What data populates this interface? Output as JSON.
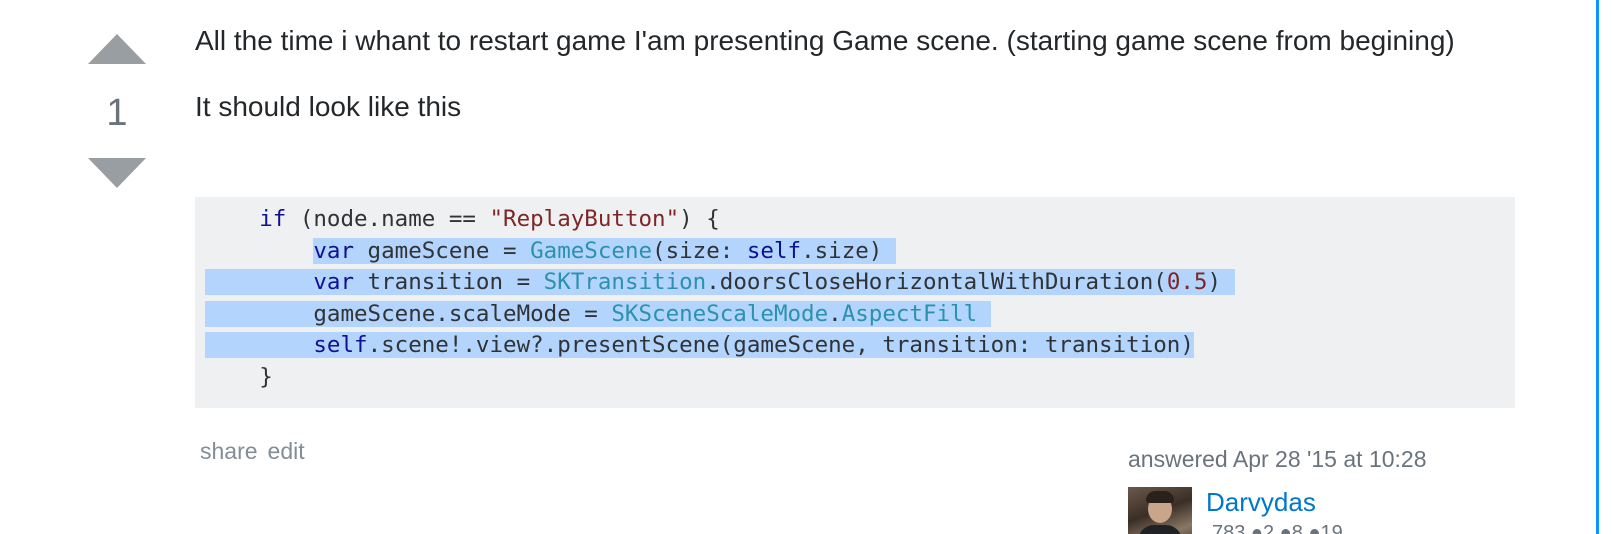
{
  "vote": {
    "count": "1"
  },
  "post": {
    "paragraph1": "All the time i whant to restart game I'am presenting Game scene. (starting game scene from begining)",
    "paragraph2": "It should look like this"
  },
  "code": {
    "line1": {
      "indent": "    ",
      "kw_if": "if",
      "t1": " (node.name == ",
      "str": "\"ReplayButton\"",
      "t2": ") {"
    },
    "line2": {
      "indent": "        ",
      "kw": "var",
      "t1": " gameScene = ",
      "type": "GameScene",
      "t2": "(size: ",
      "kw_self": "self",
      "t3": ".size)"
    },
    "line3": {
      "indent": "        ",
      "kw": "var",
      "t1": " transition = ",
      "type": "SKTransition",
      "t2": ".doorsCloseHorizontalWithDuration(",
      "num": "0.5",
      "t3": ")"
    },
    "line4": {
      "indent": "        ",
      "t1": "gameScene.scaleMode = ",
      "type": "SKSceneScaleMode",
      "t2": ".",
      "type2": "AspectFill"
    },
    "line5": {
      "indent": "        ",
      "kw_self": "self",
      "t1": ".scene!.view?.presentScene(gameScene, transition: transition)"
    },
    "line6": {
      "indent": "    ",
      "t1": "}"
    }
  },
  "menu": {
    "share": "share",
    "edit": "edit"
  },
  "user": {
    "answered": "answered Apr 28 '15 at 10:28",
    "name": "Darvydas",
    "reputation": "783 ●2 ●8 ●19"
  },
  "colors": {
    "accent_link": "#0077cc",
    "selection": "#b3d4fc",
    "code_bg": "#eff0f1",
    "vote_arrow": "#999ea3"
  }
}
